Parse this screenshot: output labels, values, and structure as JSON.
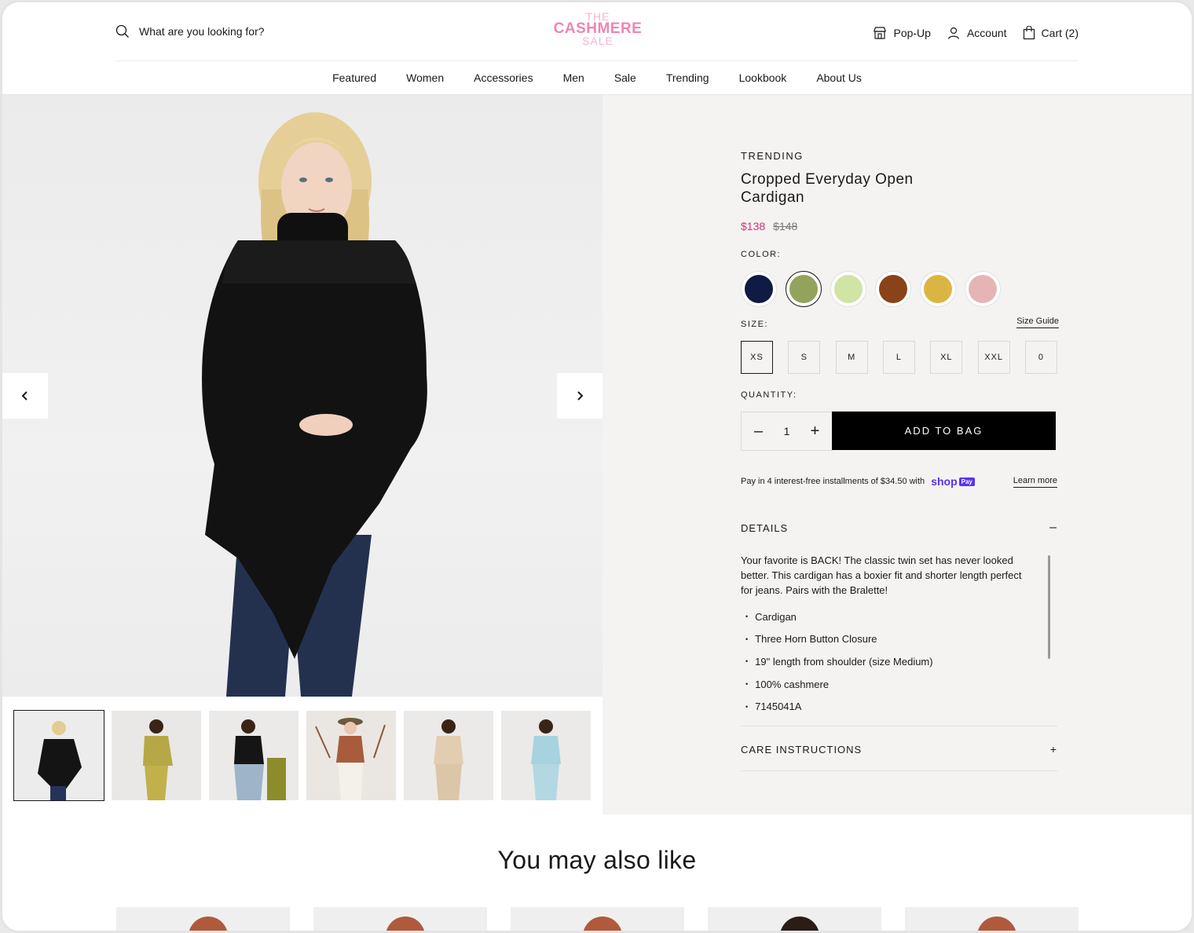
{
  "header": {
    "search_placeholder": "What are you looking for?",
    "logo": {
      "line1": "THE",
      "line2": "CASHMERE",
      "line3": "SALE"
    },
    "links": {
      "popup": "Pop-Up",
      "account": "Account",
      "cart": "Cart (2)"
    },
    "nav": [
      "Featured",
      "Women",
      "Accessories",
      "Men",
      "Sale",
      "Trending",
      "Lookbook",
      "About Us"
    ]
  },
  "product": {
    "eyebrow": "TRENDING",
    "title": "Cropped Everyday Open Cardigan",
    "price": "$138",
    "compare_price": "$148",
    "color_label": "COLOR:",
    "colors": [
      "#0f1a45",
      "#93a35c",
      "#cfe4a5",
      "#8a4218",
      "#dbb544",
      "#e6b4b5"
    ],
    "selected_color_index": 1,
    "size_label": "SIZE:",
    "size_guide": "Size Guide",
    "sizes": [
      "XS",
      "S",
      "M",
      "L",
      "XL",
      "XXL",
      "0"
    ],
    "selected_size": "XS",
    "quantity_label": "QUANTITY:",
    "quantity": "1",
    "add_to_bag": "ADD TO BAG",
    "pay_text": "Pay in 4 interest-free installments of $34.50 with",
    "shop_pay": "shop",
    "shop_pay_tag": "Pay",
    "learn_more": "Learn more",
    "details_title": "DETAILS",
    "details_toggle": "–",
    "details_text": "Your favorite is BACK! The classic twin set has never looked better. This cardigan has a boxier fit and shorter length perfect for jeans. Pairs with the Bralette!",
    "bullets": [
      "Cardigan",
      "Three Horn Button Closure",
      "19\" length from shoulder (size Medium)",
      "100% cashmere",
      "7145041A"
    ],
    "care_title": "CARE INSTRUCTIONS",
    "care_toggle": "+"
  },
  "recommendations": {
    "title": "You may also like"
  },
  "icons": {
    "prev": "chevron-left-icon",
    "next": "chevron-right-icon"
  }
}
